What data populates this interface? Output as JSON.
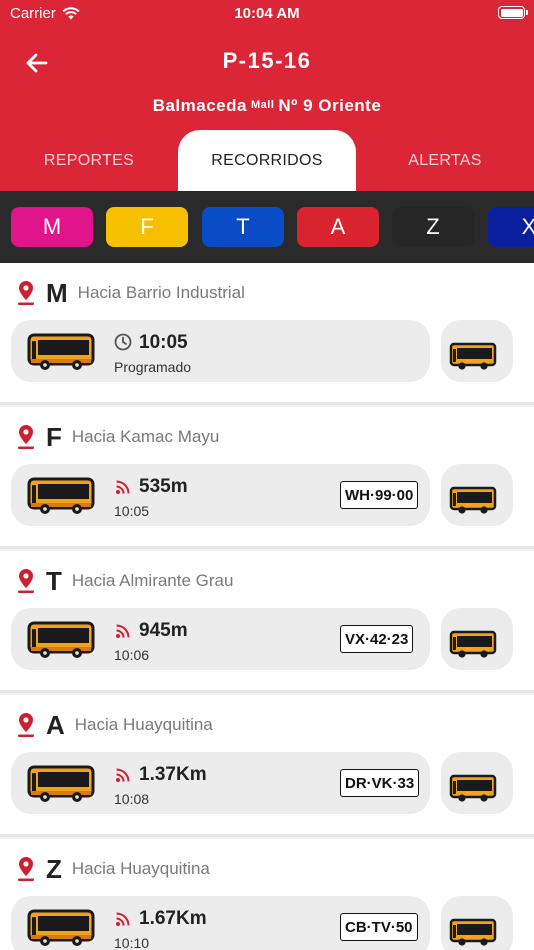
{
  "status_bar": {
    "carrier": "Carrier",
    "time": "10:04 AM"
  },
  "header": {
    "stop_code": "P-15-16",
    "stop_name_part1": "Balmaceda",
    "stop_name_small": "Mall",
    "stop_name_part2": "Nº 9 Oriente"
  },
  "tabs": [
    {
      "label": "REPORTES"
    },
    {
      "label": "RECORRIDOS"
    },
    {
      "label": "ALERTAS"
    }
  ],
  "line_chips": [
    {
      "label": "M",
      "color": "#e0148b"
    },
    {
      "label": "F",
      "color": "#f6c000"
    },
    {
      "label": "T",
      "color": "#0a4bc6"
    },
    {
      "label": "A",
      "color": "#d9232e"
    },
    {
      "label": "Z",
      "color": "#262626"
    },
    {
      "label": "X",
      "color": "#0a1f9e"
    }
  ],
  "routes": [
    {
      "letter": "M",
      "destination": "Hacia Barrio Industrial",
      "kind": "scheduled",
      "value": "10:05",
      "sub": "Programado"
    },
    {
      "letter": "F",
      "destination": "Hacia Kamac Mayu",
      "kind": "live",
      "value": "535m",
      "sub": "10:05",
      "plate": "WH·99·00"
    },
    {
      "letter": "T",
      "destination": "Hacia Almirante Grau",
      "kind": "live",
      "value": "945m",
      "sub": "10:06",
      "plate": "VX·42·23"
    },
    {
      "letter": "A",
      "destination": "Hacia Huayquitina",
      "kind": "live",
      "value": "1.37Km",
      "sub": "10:08",
      "plate": "DR·VK·33"
    },
    {
      "letter": "Z",
      "destination": "Hacia Huayquitina",
      "kind": "live",
      "value": "1.67Km",
      "sub": "10:10",
      "plate": "CB·TV·50"
    }
  ],
  "icons": {
    "back": "arrow-left-icon",
    "pin": "map-pin-icon",
    "clock": "clock-icon",
    "signal": "live-signal-icon",
    "bus": "bus-icon"
  },
  "colors": {
    "brand_red": "#db2638",
    "pin_red": "#d01e33",
    "signal_red": "#d0202f",
    "bus_body": "#f4a21a"
  }
}
